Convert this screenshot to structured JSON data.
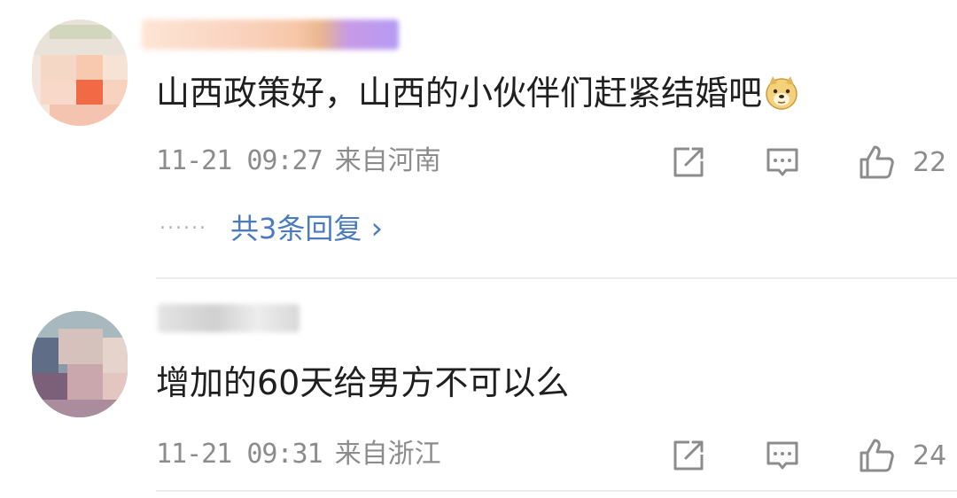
{
  "comments": [
    {
      "text": "山西政策好，山西的小伙伴们赶紧结婚吧",
      "emoji": "doge-emoji",
      "timestamp": "11-21 09:27",
      "location": "来自河南",
      "likes": "22",
      "replies_label": "共3条回复",
      "replies_chevron": "›",
      "dots": "······"
    },
    {
      "text": "增加的60天给男方不可以么",
      "timestamp": "11-21 09:31",
      "location": "来自浙江",
      "likes": "24"
    }
  ],
  "icons": {
    "share": "share-icon",
    "comment": "comment-icon",
    "like": "like-icon"
  },
  "colors": {
    "text": "#1f1f1f",
    "meta": "#8c8c8c",
    "link": "#4a7bc0",
    "divider": "#ececec"
  }
}
